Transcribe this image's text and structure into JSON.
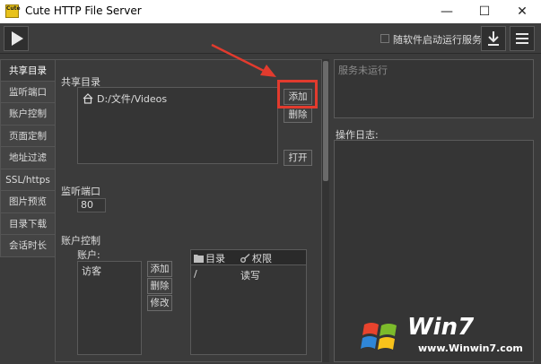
{
  "window": {
    "title": "Cute HTTP File Server",
    "icon_text": "Cute"
  },
  "toolbar": {
    "autostart_label": "随软件启动运行服务"
  },
  "tabs": [
    "共享目录",
    "监听端口",
    "账户控制",
    "页面定制",
    "地址过滤",
    "SSL/https",
    "图片预览",
    "目录下载",
    "会话时长"
  ],
  "shared_dir": {
    "title": "共享目录",
    "folder": "D:/文件/Videos",
    "add_label": "添加",
    "delete_label": "删除",
    "open_label": "打开"
  },
  "listen_port": {
    "title": "监听端口",
    "value": "80"
  },
  "account": {
    "title": "账户控制",
    "accounts_label": "账户:",
    "user": "访客",
    "add_label": "添加",
    "delete_label": "删除",
    "modify_label": "修改",
    "table": {
      "col_dir": "目录",
      "col_perm": "权限",
      "row_dir": "/",
      "row_perm": "读写"
    }
  },
  "status": {
    "text": "服务未运行"
  },
  "log": {
    "label": "操作日志:"
  },
  "watermark": {
    "logo": "Win7",
    "url": "www.Winwin7.com"
  },
  "colors": {
    "highlight": "#e23b2e",
    "background": "#3b3b3b"
  }
}
